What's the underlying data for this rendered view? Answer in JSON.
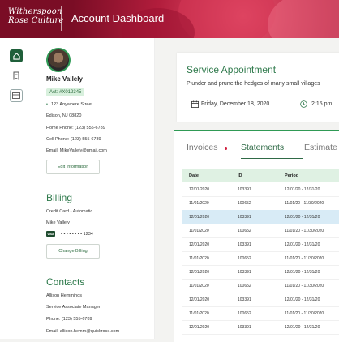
{
  "header": {
    "logo_line1": "Witherspoon",
    "logo_line2": "Rose Culture",
    "title": "Account Dashboard"
  },
  "rail": {
    "icons": [
      "home-icon",
      "bill-icon",
      "card-icon"
    ]
  },
  "profile": {
    "name": "Mike Vallely",
    "account": "Act: #X012345",
    "address1": "123 Anywhere Street",
    "address2": "Edison, NJ 08820",
    "home_phone": "Home Phone: (123) 555-6789",
    "cell_phone": "Cell Phone: (123) 555-6789",
    "email": "Email: MikeVallely@gmail.com",
    "edit_button": "Edit Information"
  },
  "billing": {
    "title": "Billing",
    "method": "Credit Card - Automatic",
    "holder": "Mike Vallely",
    "card_brand": "VISA",
    "card_number": "• • • • • • • • 1234",
    "change_button": "Change Billing"
  },
  "contacts": {
    "title": "Contacts",
    "name": "Allison Hemmings",
    "role": "Service Associate Manager",
    "phone": "Phone: (123) 555-6789",
    "email": "Email: allison.hemm@quickrose.com"
  },
  "service": {
    "title": "Service Appointment",
    "description": "Plunder and prune the hedges of many small villages",
    "date": "Friday, December 18, 2020",
    "time": "2:15 pm"
  },
  "tabs": [
    {
      "label": "Invoices"
    },
    {
      "label": "Statements"
    },
    {
      "label": "Estimate"
    }
  ],
  "table": {
    "columns": [
      "Date",
      "ID",
      "Period"
    ],
    "rows": [
      {
        "date": "12/01/2020",
        "id": "103391",
        "period": "12/01/20 - 12/31/20"
      },
      {
        "date": "11/01/2020",
        "id": "100652",
        "period": "11/01/20 - 11/30/2020"
      },
      {
        "date": "12/01/2020",
        "id": "103391",
        "period": "12/01/20 - 12/31/20"
      },
      {
        "date": "11/01/2020",
        "id": "100652",
        "period": "11/01/20 - 11/30/2020"
      },
      {
        "date": "12/01/2020",
        "id": "103391",
        "period": "12/01/20 - 12/31/20"
      },
      {
        "date": "11/01/2020",
        "id": "100652",
        "period": "11/01/20 - 11/30/2020"
      },
      {
        "date": "12/01/2020",
        "id": "103391",
        "period": "12/01/20 - 12/31/20"
      },
      {
        "date": "11/01/2020",
        "id": "100652",
        "period": "11/01/20 - 11/30/2020"
      },
      {
        "date": "12/01/2020",
        "id": "103391",
        "period": "12/01/20 - 12/31/20"
      },
      {
        "date": "11/01/2020",
        "id": "100652",
        "period": "11/01/20 - 11/30/2020"
      },
      {
        "date": "12/01/2020",
        "id": "103391",
        "period": "12/01/20 - 12/31/20"
      }
    ]
  },
  "colors": {
    "brand_red": "#b21d3c",
    "accent_green": "#2f7a4c",
    "selected_row": "#d8ebf6"
  }
}
